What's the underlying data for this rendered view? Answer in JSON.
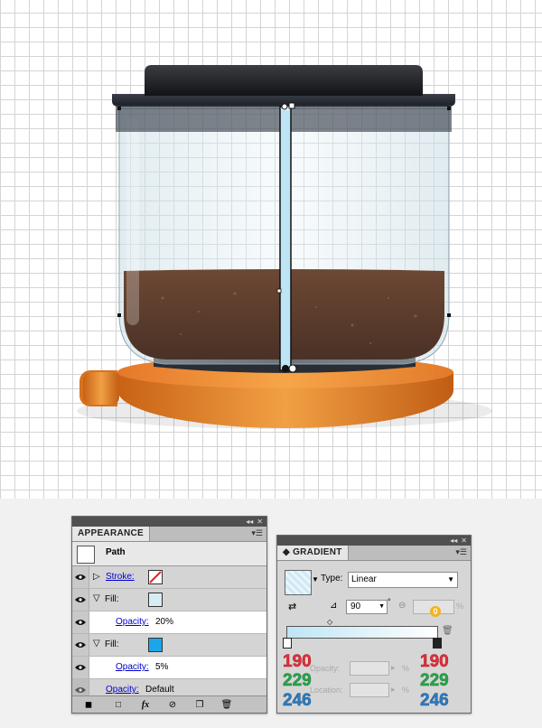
{
  "appearance": {
    "title": "APPEARANCE",
    "header": "Path",
    "rows": [
      {
        "label": "Stroke:",
        "swatch": "#ffffff"
      },
      {
        "label": "Fill:",
        "swatch": "#d8ecf3"
      },
      {
        "opacity_label": "Opacity:",
        "opacity_value": "20%"
      },
      {
        "label": "Fill:",
        "swatch": "#1aa7ea"
      },
      {
        "opacity_label": "Opacity:",
        "opacity_value": "5%"
      },
      {
        "opacity_label": "Opacity:",
        "opacity_value": "Default"
      }
    ],
    "footer_fx": "fx"
  },
  "gradient": {
    "title": "GRADIENT",
    "type_label": "Type:",
    "type_value": "Linear",
    "angle_value": "90",
    "aspect_value": "0",
    "opacity_label": "Opacity:",
    "location_label": "Location:",
    "percent": "%",
    "ramp_start": "#bee5f6",
    "ramp_end": "#ffffff",
    "r": "190",
    "g": "229",
    "b": "246"
  },
  "colors": {
    "cap_dark": "#1e1f24",
    "liquid": "#6a4630",
    "base_orange": "#e8832a"
  }
}
